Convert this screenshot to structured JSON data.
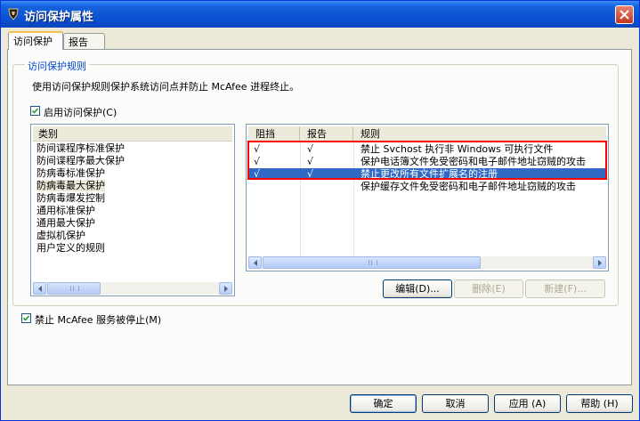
{
  "window": {
    "title": "访问保护属性"
  },
  "tabs": [
    {
      "label": "访问保护",
      "active": true
    },
    {
      "label": "报告",
      "active": false
    }
  ],
  "group": {
    "legend": "访问保护规则",
    "description": "使用访问保护规则保护系统访问点并防止 McAfee 进程终止。",
    "enable_checkbox": {
      "label": "启用访问保护(C)",
      "checked": true
    }
  },
  "categories": {
    "header": "类别",
    "items": [
      "防间谍程序标准保护",
      "防间谍程序最大保护",
      "防病毒标准保护",
      "防病毒最大保护",
      "防病毒爆发控制",
      "通用标准保护",
      "通用最大保护",
      "虚拟机保护",
      "用户定义的规则"
    ],
    "selected_index": 3
  },
  "rules": {
    "columns": [
      "阻挡",
      "报告",
      "规则"
    ],
    "rows": [
      {
        "block": "√",
        "report": "√",
        "rule": "禁止 Svchost 执行非 Windows 可执行文件",
        "selected": false
      },
      {
        "block": "√",
        "report": "√",
        "rule": "保护电话簿文件免受密码和电子邮件地址窃贼的攻击",
        "selected": false
      },
      {
        "block": "√",
        "report": "√",
        "rule": "禁止更改所有文件扩展名的注册",
        "selected": true
      },
      {
        "block": "",
        "report": "",
        "rule": "保护缓存文件免受密码和电子邮件地址窃贼的攻击",
        "selected": false
      }
    ],
    "highlight_color": "#ff0000",
    "selection_color": "#316ac5"
  },
  "rule_buttons": {
    "edit": "编辑(D)...",
    "delete": "删除(E)",
    "new": "新建(F)..."
  },
  "stop_checkbox": {
    "label": "禁止 McAfee 服务被停止(M)",
    "checked": true
  },
  "dialog_buttons": {
    "ok": "确定",
    "cancel": "取消",
    "apply": "应用 (A)",
    "help": "帮助 (H)"
  }
}
